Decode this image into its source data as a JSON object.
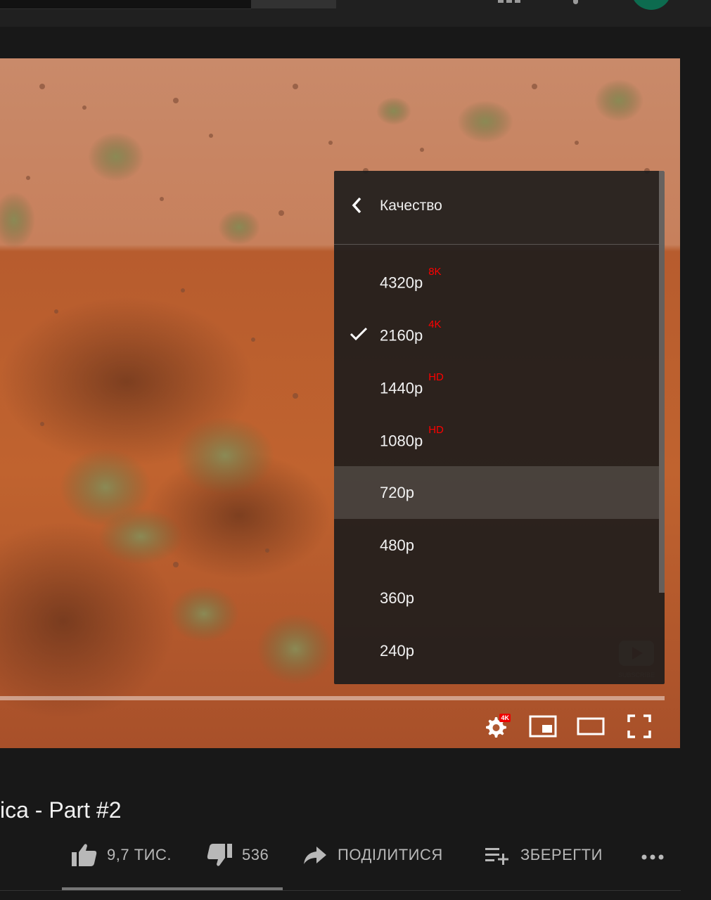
{
  "player": {
    "quality_menu": {
      "title": "Качество",
      "selected": "2160p",
      "hovered": "720p",
      "options": [
        {
          "label": "4320p",
          "badge": "8K"
        },
        {
          "label": "2160p",
          "badge": "4K"
        },
        {
          "label": "1440p",
          "badge": "HD"
        },
        {
          "label": "1080p",
          "badge": "HD"
        },
        {
          "label": "720p",
          "badge": ""
        },
        {
          "label": "480p",
          "badge": ""
        },
        {
          "label": "360p",
          "badge": ""
        },
        {
          "label": "240p",
          "badge": ""
        }
      ]
    },
    "controls": {
      "settings_badge": "4K"
    },
    "colors": {
      "accent_red": "#ff0000",
      "badge_red": "#e00000"
    }
  },
  "video": {
    "title": "ica - Part #2"
  },
  "actions": {
    "like_count": "9,7 ТИС.",
    "dislike_count": "536",
    "share_label": "ПОДІЛИТИСЯ",
    "save_label": "ЗБЕРЕГТИ"
  },
  "icons": [
    "apps-icon",
    "bell-icon",
    "back-arrow-icon",
    "check-icon",
    "settings-gear-icon",
    "miniplayer-icon",
    "theater-mode-icon",
    "fullscreen-icon",
    "thumbs-up-icon",
    "thumbs-down-icon",
    "share-arrow-icon",
    "playlist-add-icon",
    "more-dots-icon"
  ]
}
